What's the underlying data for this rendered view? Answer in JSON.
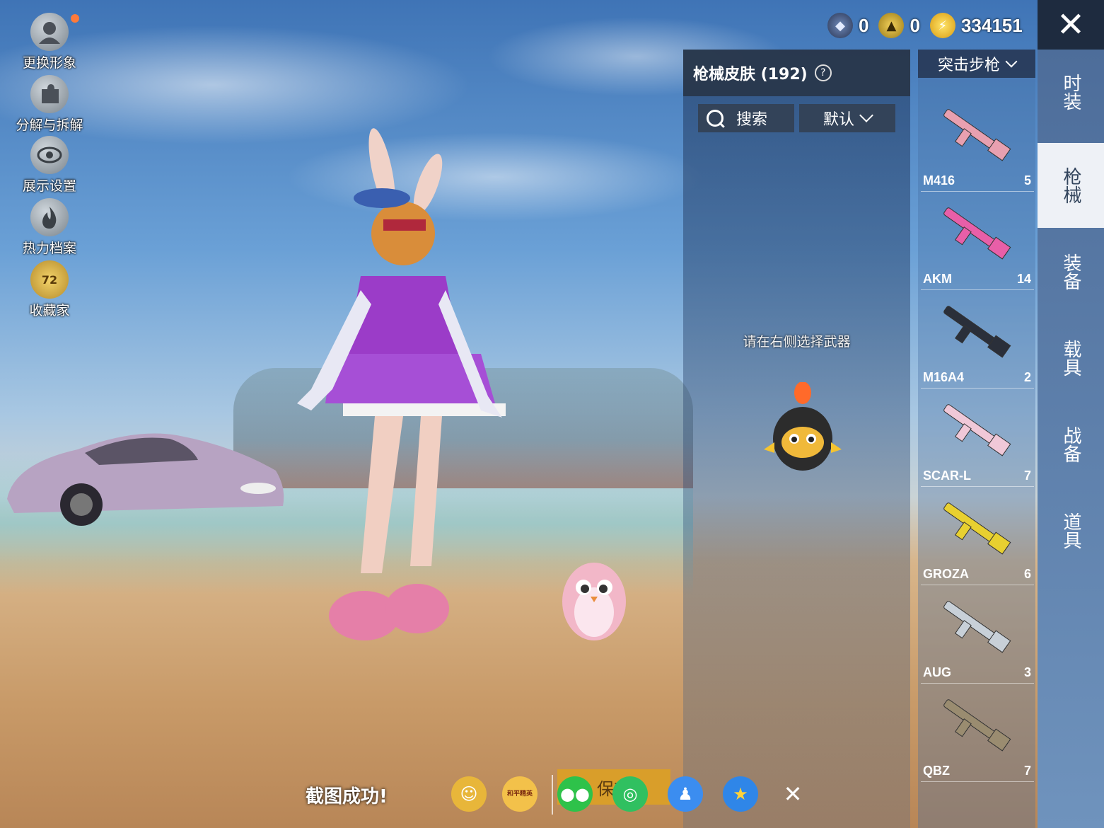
{
  "left_menu": [
    {
      "label": "更换形象",
      "icon": "avatar-icon"
    },
    {
      "label": "分解与拆解",
      "icon": "puzzle-icon"
    },
    {
      "label": "展示设置",
      "icon": "eye-icon"
    },
    {
      "label": "热力档案",
      "icon": "flame-icon"
    },
    {
      "label": "收藏家",
      "icon": "collector-badge-icon",
      "badge": "72"
    }
  ],
  "currencies": [
    {
      "icon": "token-icon",
      "value": "0"
    },
    {
      "icon": "coin-icon",
      "value": "0"
    },
    {
      "icon": "lightning-icon",
      "value": "334151"
    }
  ],
  "skin_panel": {
    "title": "枪械皮肤 (192)",
    "help_symbol": "?",
    "search_label": "搜索",
    "sort_label": "默认",
    "hint": "请在右侧选择武器"
  },
  "weapon_category": "突击步枪",
  "weapons": [
    {
      "name": "M416",
      "count": "5",
      "color": "#e8a0b0"
    },
    {
      "name": "AKM",
      "count": "14",
      "color": "#e85fa8"
    },
    {
      "name": "M16A4",
      "count": "2",
      "color": "#2a2f3a"
    },
    {
      "name": "SCAR-L",
      "count": "7",
      "color": "#f0c8d8"
    },
    {
      "name": "GROZA",
      "count": "6",
      "color": "#e8d030"
    },
    {
      "name": "AUG",
      "count": "3",
      "color": "#c8d0d8"
    },
    {
      "name": "QBZ",
      "count": "7",
      "color": "#9a8c70"
    }
  ],
  "tabs": [
    {
      "label": "时装",
      "active": false
    },
    {
      "label": "枪械",
      "active": true
    },
    {
      "label": "装备",
      "active": false
    },
    {
      "label": "载具",
      "active": false
    },
    {
      "label": "战备",
      "active": false
    },
    {
      "label": "道具",
      "active": false
    }
  ],
  "bottom": {
    "toast": "截图成功!",
    "save_label": "保存",
    "share_icons": [
      "friend-share-icon",
      "game-logo-icon",
      "wechat-icon",
      "moments-icon",
      "qq-icon",
      "qzone-icon",
      "close-icon"
    ],
    "game_logo_text": "和平精英"
  },
  "close_symbol": "✕"
}
